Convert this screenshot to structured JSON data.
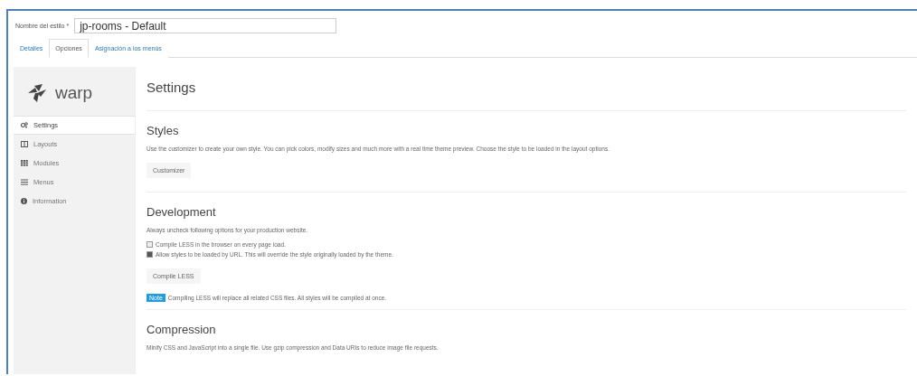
{
  "style_name": {
    "label": "Nombre del estilo *",
    "value": "jp-rooms - Default"
  },
  "tabs": [
    {
      "label": "Detalles",
      "selected": false
    },
    {
      "label": "Opciones",
      "selected": true
    },
    {
      "label": "Asignación a los menús",
      "selected": false
    }
  ],
  "sidebar": {
    "logo": "warp",
    "items": [
      {
        "label": "Settings",
        "selected": true
      },
      {
        "label": "Layouts",
        "selected": false
      },
      {
        "label": "Modules",
        "selected": false
      },
      {
        "label": "Menus",
        "selected": false
      },
      {
        "label": "Information",
        "selected": false
      }
    ]
  },
  "title": "Settings",
  "sections": [
    {
      "heading": "Styles",
      "description": "Use the customizer to create your own style. You can pick colors, modify sizes and much more with a real time theme preview. Choose the style to be loaded in the layout options.",
      "button": "Customizer"
    },
    {
      "heading": "Development",
      "description": "Always uncheck following options for your production website.",
      "options": [
        {
          "label": "Compile LESS in the browser on every page load.",
          "checked": false
        },
        {
          "label": "Allow styles to be loaded by URL. This will override the style originally loaded by the theme.",
          "checked": true
        }
      ],
      "button": "Compile LESS",
      "note": {
        "badge": "Note",
        "text": "Compiling LESS will replace all related CSS files. All styles will be compiled at once."
      }
    },
    {
      "heading": "Compression",
      "description": "Minify CSS and JavaScript into a single file. Use gzip compression and Data URIs to reduce image file requests."
    }
  ]
}
